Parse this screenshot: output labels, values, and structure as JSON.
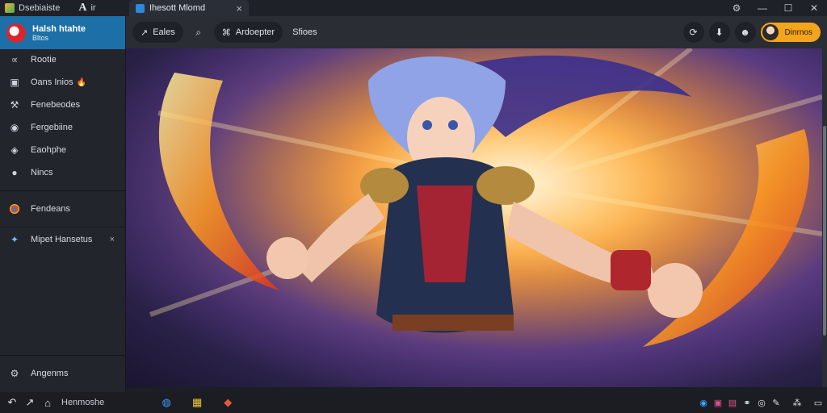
{
  "titlebar": {
    "app_name": "Dsebiaiste",
    "font_label": "ir",
    "tab_title": "Ihesott Mlomd",
    "tab_close": "×",
    "window_controls": [
      "⚙",
      "—",
      "☐",
      "✕"
    ]
  },
  "profile": {
    "name": "Halsh htahte",
    "subtitle": "Bltos"
  },
  "sidebar": {
    "items": [
      {
        "label": "Rootie",
        "icon": "fish-icon"
      },
      {
        "label": "Oans Inios",
        "icon": "image-icon",
        "badge": "🔥"
      },
      {
        "label": "Fenebeodes",
        "icon": "wrench-icon"
      },
      {
        "label": "Fergebiine",
        "icon": "shield-icon"
      },
      {
        "label": "Eaohphe",
        "icon": "controller-icon"
      },
      {
        "label": "Nincs",
        "icon": "disc-icon"
      }
    ],
    "app_item": {
      "label": "Fendeans",
      "icon": "chrome-icon"
    },
    "pinned_item": {
      "label": "Mipet Hansetus",
      "icon": "sparkle-icon",
      "close": "×"
    },
    "bottom_item": {
      "label": "Angenms",
      "icon": "settings-icon"
    }
  },
  "toolbar": {
    "nav_label": "Eales",
    "filter_label": "Ardoepter",
    "text_label": "Sfioes",
    "account_label": "Dinrnos"
  },
  "taskbar": {
    "search_label": "Henmoshe",
    "tray_text": "⁂"
  },
  "colors": {
    "accent_blue": "#1d6fa8",
    "accent_orange": "#f3a51c",
    "sidebar_bg": "#22252c",
    "toolbar_bg": "#2a2d34"
  }
}
